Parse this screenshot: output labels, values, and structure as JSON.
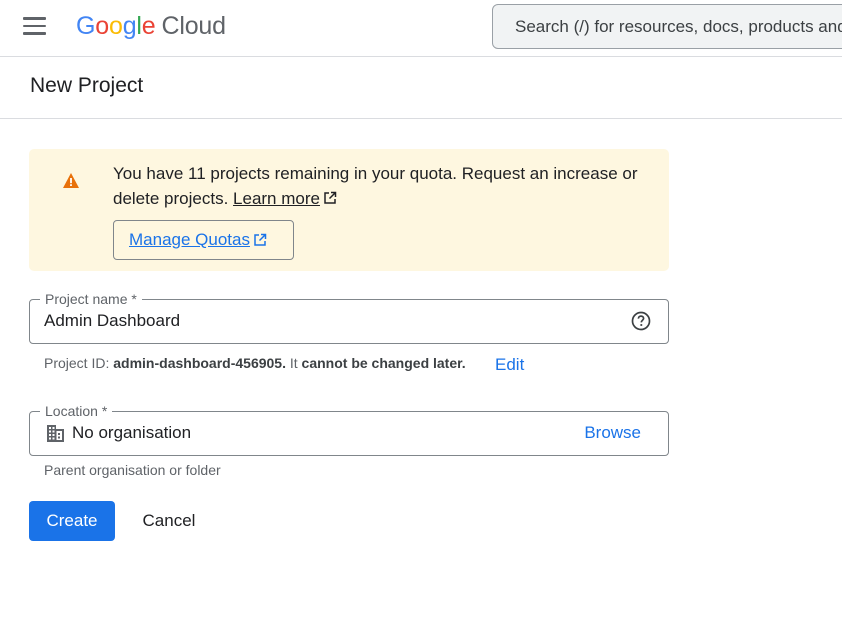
{
  "header": {
    "logo_letters": [
      "G",
      "o",
      "o",
      "g",
      "l",
      "e"
    ],
    "logo_product": "Cloud",
    "search_placeholder": "Search (/) for resources, docs, products and more"
  },
  "page": {
    "title": "New Project"
  },
  "quota_banner": {
    "message": "You have 11 projects remaining in your quota. Request an increase or delete projects.",
    "learn_more": "Learn more",
    "manage_button": "Manage Quotas",
    "icon": "warning-icon",
    "background_color": "#fef7e0",
    "icon_color": "#e8710a"
  },
  "project_name": {
    "label": "Project name *",
    "value": "Admin Dashboard",
    "help_icon": "help-circle-icon"
  },
  "project_id": {
    "prefix": "Project ID:",
    "id": "admin-dashboard-456905.",
    "middle": "It",
    "suffix": "cannot be changed later.",
    "edit_label": "Edit"
  },
  "location": {
    "label": "Location *",
    "value": "No organisation",
    "browse_label": "Browse",
    "hint": "Parent organisation or folder",
    "icon": "organisation-building-icon"
  },
  "actions": {
    "create_label": "Create",
    "cancel_label": "Cancel",
    "primary_color": "#1a73e8"
  }
}
